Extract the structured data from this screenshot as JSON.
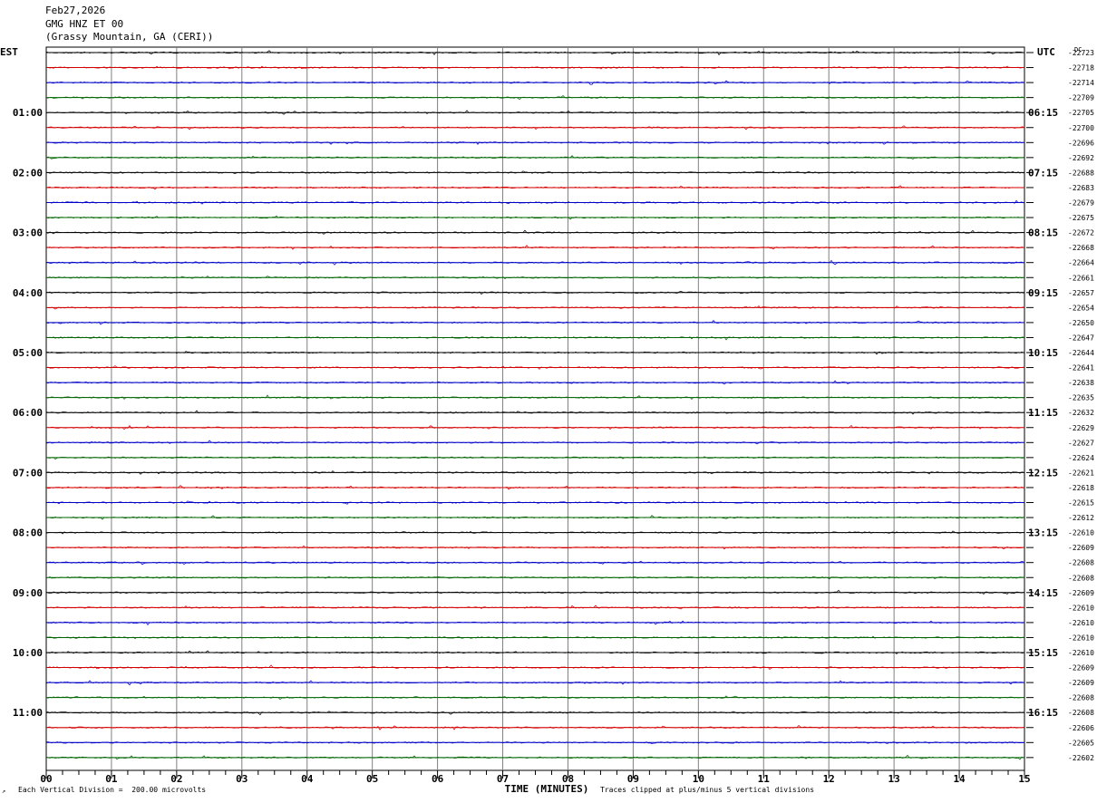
{
  "header": {
    "date": "Feb27,2026",
    "station": "GMG HNZ ET 00",
    "location": "(Grassy Mountain, GA (CERI))"
  },
  "axis_labels": {
    "left_zone": "EST",
    "right_zone": "UTC",
    "right_column": "DC"
  },
  "footer": {
    "scale_text": "Each Vertical Division =  200.00 microvolts",
    "clip_text": "Traces clipped at plus/minus 5 vertical divisions"
  },
  "chart_data": {
    "type": "line",
    "xlabel": "TIME (MINUTES)",
    "xlim": [
      0,
      15
    ],
    "x_ticks": [
      "00",
      "01",
      "02",
      "03",
      "04",
      "05",
      "06",
      "07",
      "08",
      "09",
      "10",
      "11",
      "12",
      "13",
      "14",
      "15"
    ],
    "row_minutes": 15,
    "grid": true,
    "trace_colors": [
      "#000000",
      "#d40000",
      "#0000c8",
      "#006400"
    ],
    "est_hour_labels": [
      "01:00",
      "02:00",
      "03:00",
      "04:00",
      "05:00",
      "06:00",
      "07:00",
      "08:00",
      "09:00",
      "10:00",
      "11:00"
    ],
    "utc_hour_labels": [
      "06:15",
      "07:15",
      "08:15",
      "09:15",
      "10:15",
      "11:15",
      "12:15",
      "13:15",
      "14:15",
      "15:15",
      "16:15"
    ],
    "dc_offsets": [
      "-22723",
      "-22718",
      "-22714",
      "-22709",
      "-22705",
      "-22700",
      "-22696",
      "-22692",
      "-22688",
      "-22683",
      "-22679",
      "-22675",
      "-22672",
      "-22668",
      "-22664",
      "-22661",
      "-22657",
      "-22654",
      "-22650",
      "-22647",
      "-22644",
      "-22641",
      "-22638",
      "-22635",
      "-22632",
      "-22629",
      "-22627",
      "-22624",
      "-22621",
      "-22618",
      "-22615",
      "-22612",
      "-22610",
      "-22609",
      "-22608",
      "-22608",
      "-22609",
      "-22610",
      "-22610",
      "-22610",
      "-22610",
      "-22609",
      "-22609",
      "-22608",
      "-22608",
      "-22606",
      "-22605",
      "-22602"
    ]
  }
}
